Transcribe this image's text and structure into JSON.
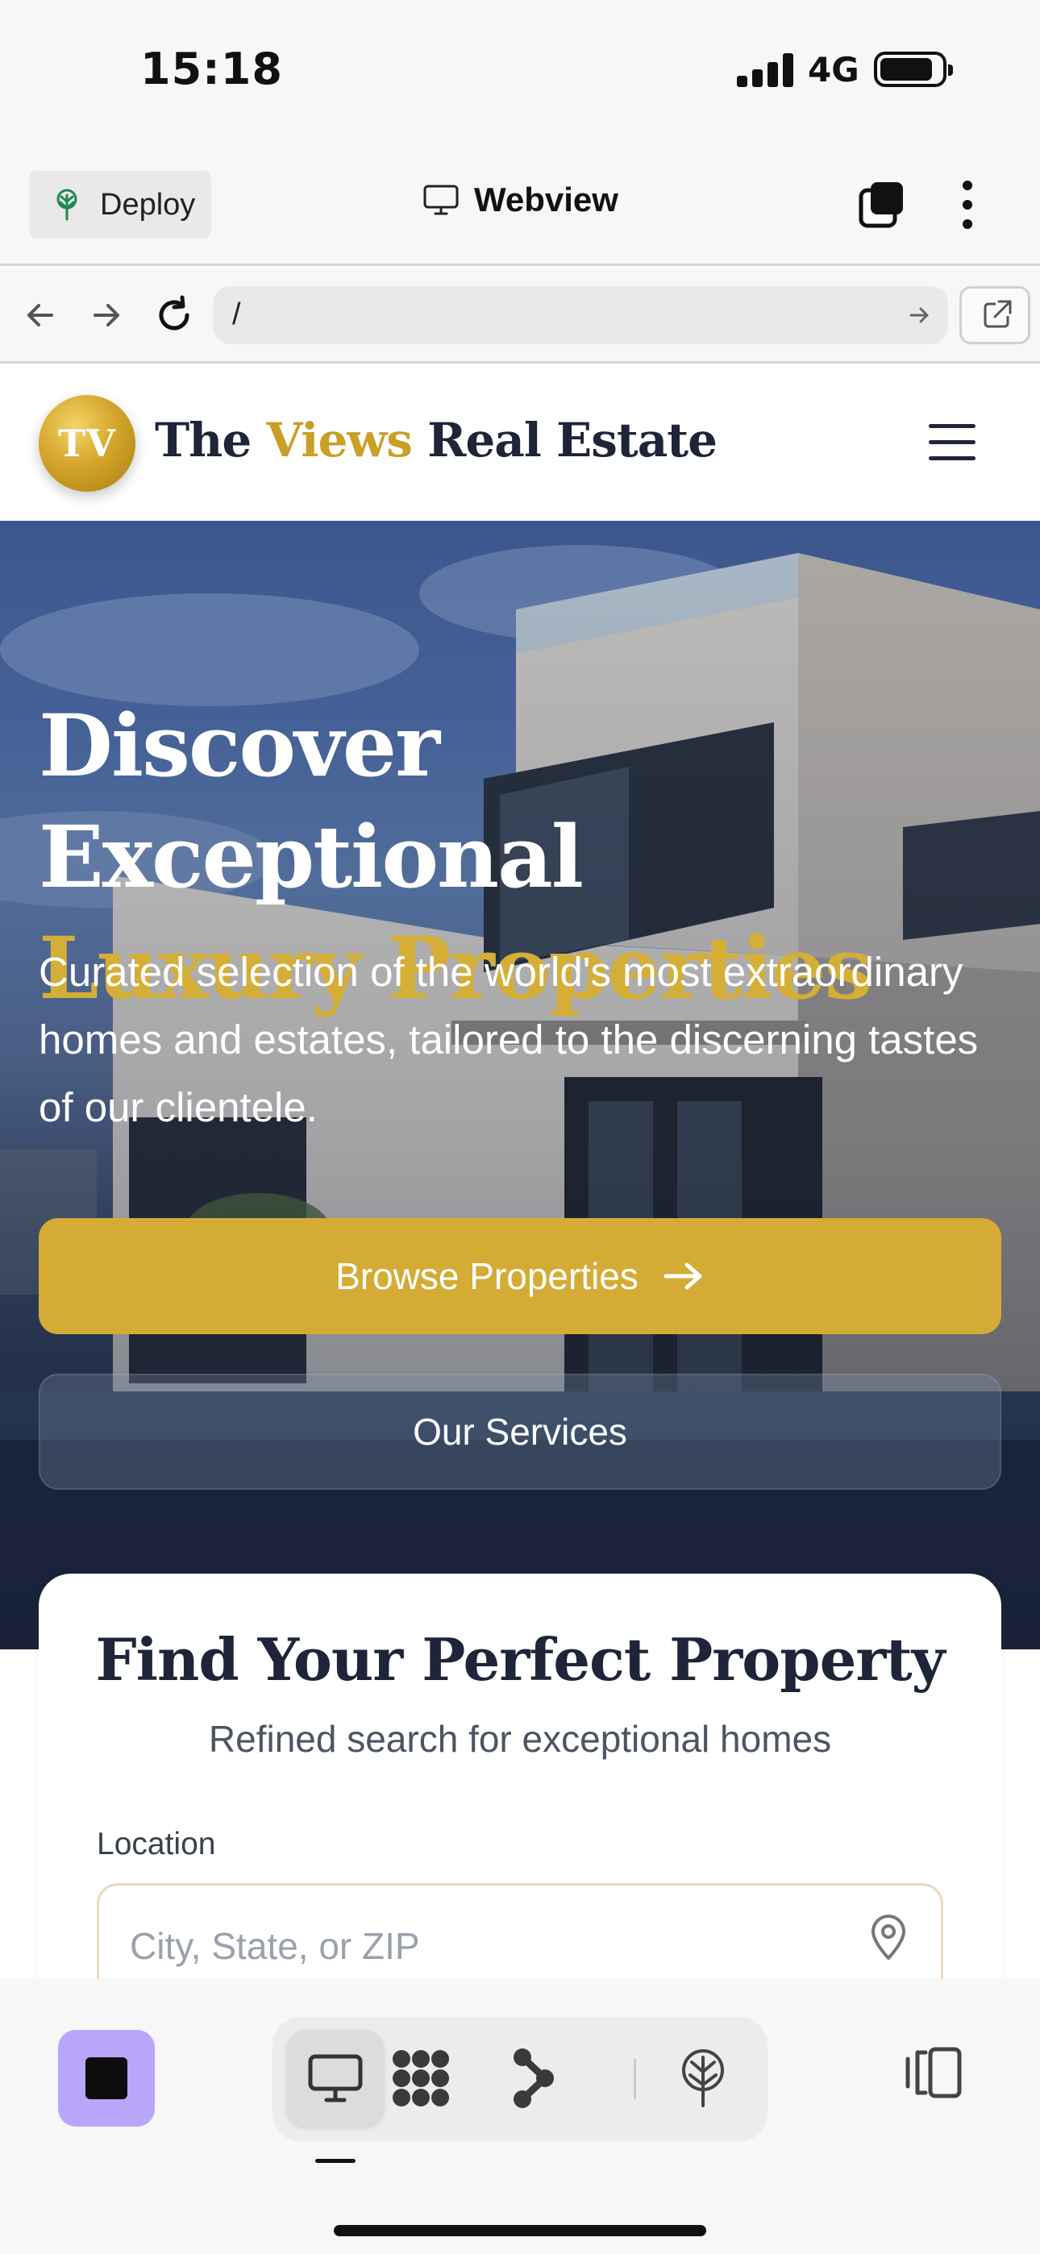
{
  "status_bar": {
    "time": "15:18",
    "network": "4G"
  },
  "app_bar": {
    "deploy_label": "Deploy",
    "title": "Webview"
  },
  "url_bar": {
    "path": "/"
  },
  "site": {
    "logo_initials": "TV",
    "brand_parts": [
      "The ",
      "Views",
      " Real Estate"
    ],
    "brand_accent_color": "#c99f25"
  },
  "hero": {
    "title_line1": "Discover Exceptional",
    "title_line2": "Luxury Properties",
    "subtitle": "Curated selection of the world's most extraordinary homes and estates, tailored to the discerning tastes of our clientele.",
    "primary_button": "Browse Properties",
    "secondary_button": "Our Services",
    "gold_color": "#d4ac35"
  },
  "search_card": {
    "title": "Find Your Perfect Property",
    "subtitle": "Refined search for exceptional homes",
    "location_label": "Location",
    "location_placeholder": "City, State, or ZIP"
  },
  "bottom_toolbar": {
    "stop_color": "#b9a6fb",
    "tools": [
      {
        "icon": "monitor-icon",
        "active": true
      },
      {
        "icon": "grid-cluster-icon",
        "active": false
      },
      {
        "icon": "branch-icon",
        "active": false
      },
      {
        "icon": "deploy-tree-icon",
        "active": false
      }
    ],
    "panel_icon": "panel-toggle-icon"
  }
}
